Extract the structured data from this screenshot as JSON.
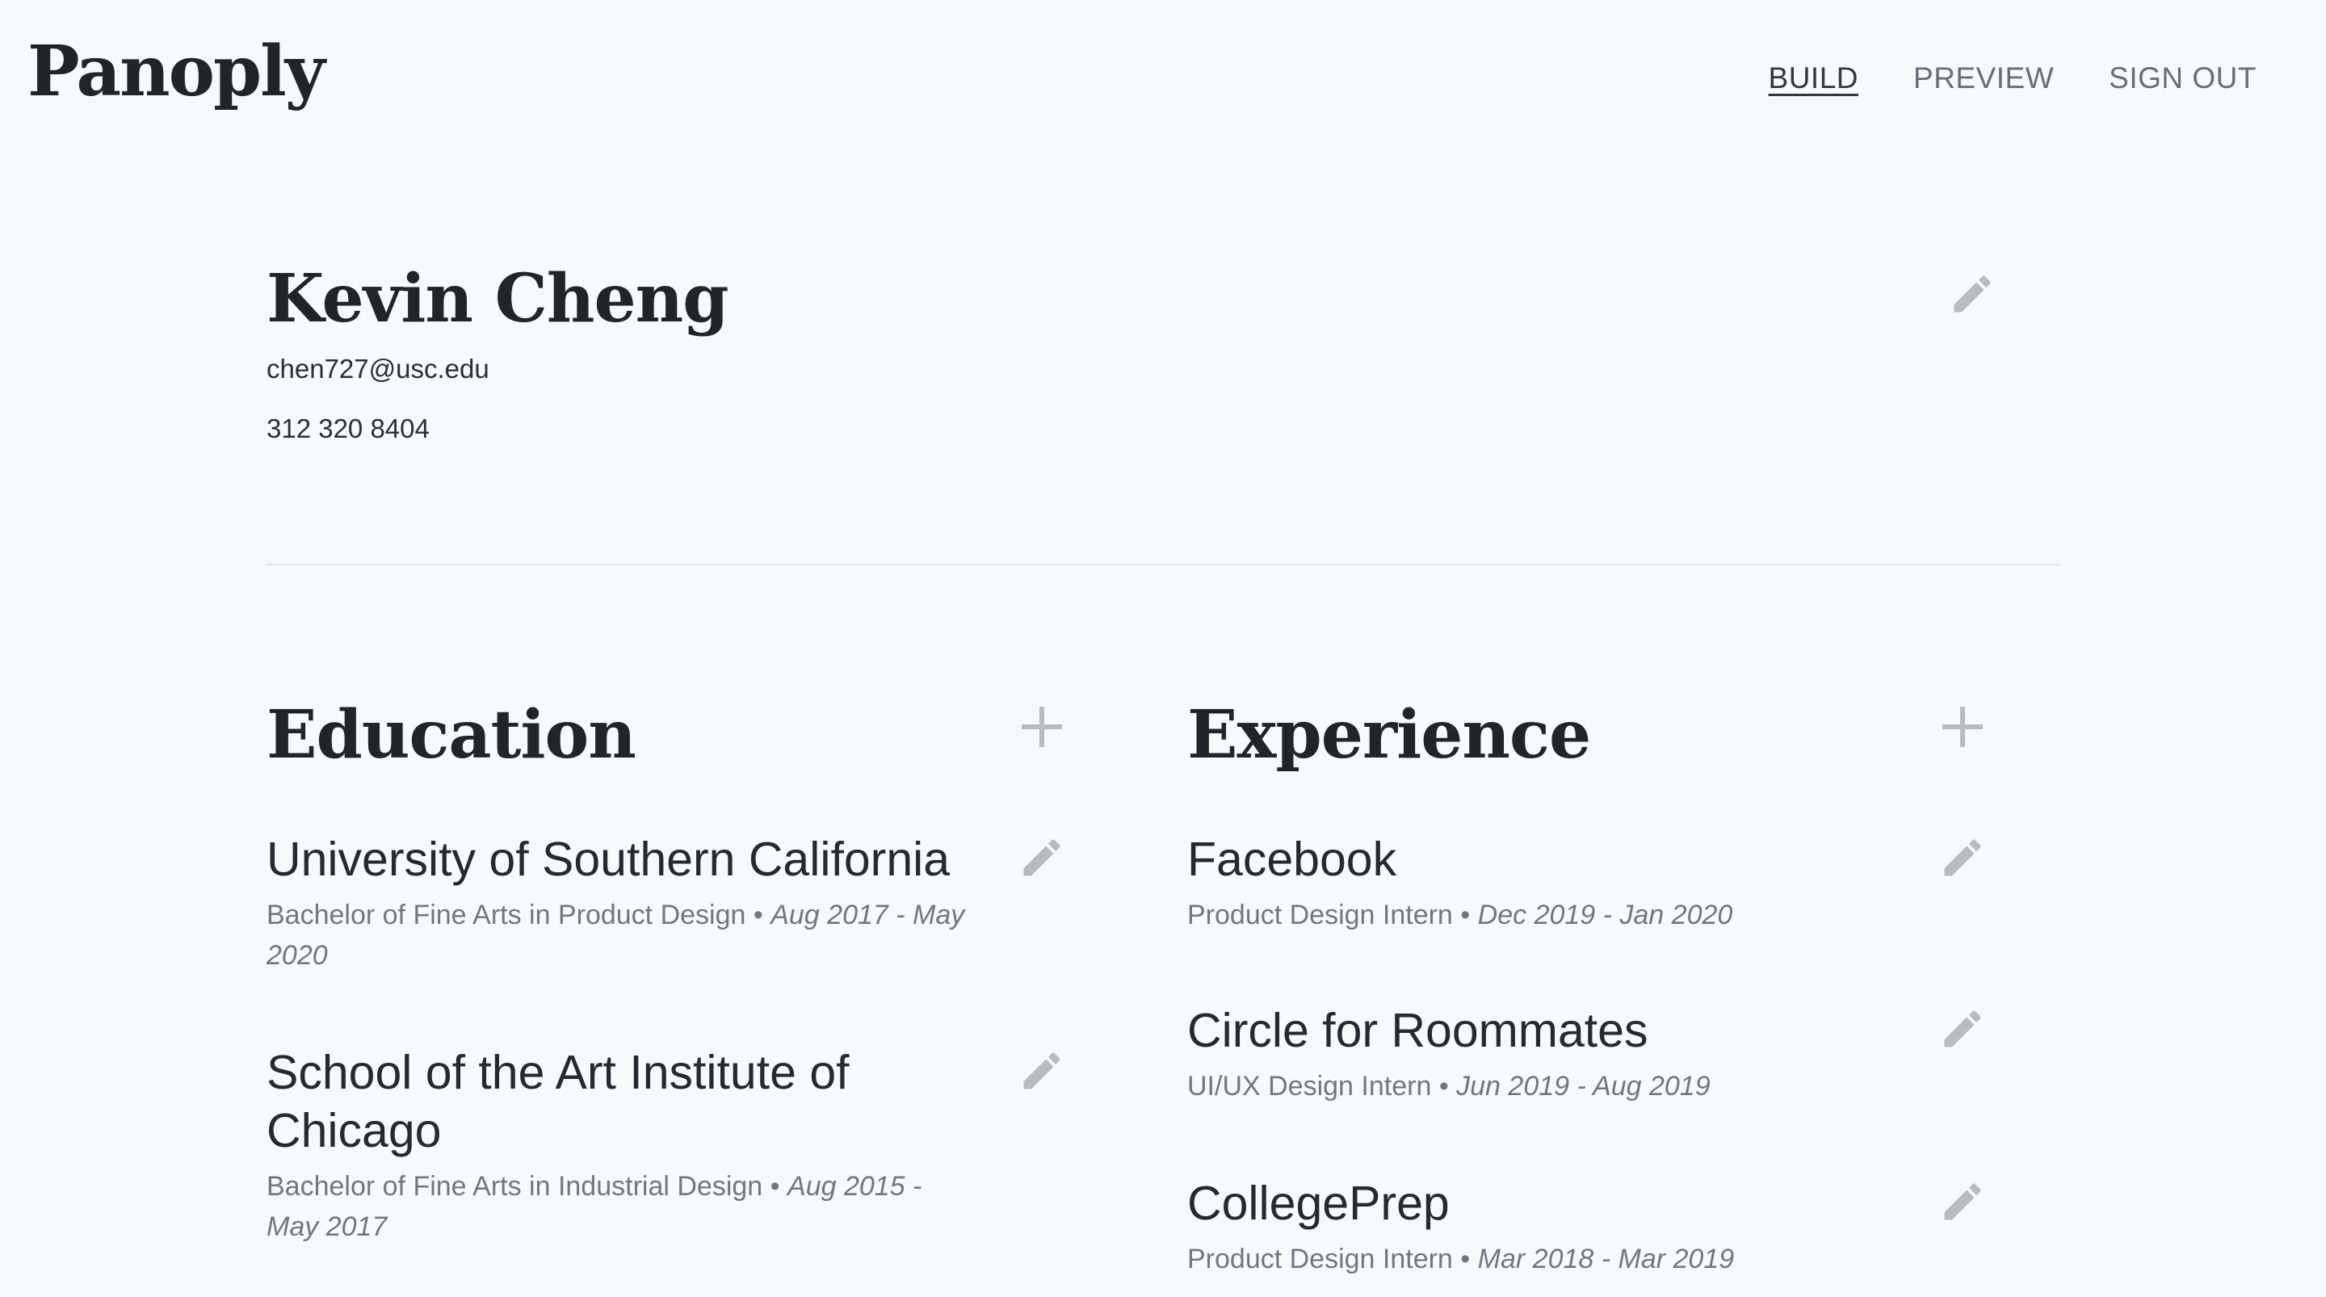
{
  "app": {
    "logo": "Panoply"
  },
  "nav": {
    "build": "BUILD",
    "preview": "PREVIEW",
    "sign_out": "SIGN OUT"
  },
  "profile": {
    "name": "Kevin Cheng",
    "email": "chen727@usc.edu",
    "phone": "312 320 8404"
  },
  "education": {
    "title": "Education",
    "entries": [
      {
        "school": "University of Southern California",
        "degree": "Bachelor of Fine Arts in Product Design",
        "separator": "•",
        "dates": "Aug 2017 - May 2020"
      },
      {
        "school": "School of the Art Institute of Chicago",
        "degree": "Bachelor of Fine Arts in Industrial Design",
        "separator": "•",
        "dates": "Aug 2015 - May 2017"
      }
    ]
  },
  "experience": {
    "title": "Experience",
    "entries": [
      {
        "company": "Facebook",
        "role": "Product Design Intern",
        "separator": "•",
        "dates": "Dec 2019 - Jan 2020"
      },
      {
        "company": "Circle for Roommates",
        "role": "UI/UX Design Intern",
        "separator": "•",
        "dates": "Jun 2019 - Aug 2019"
      },
      {
        "company": "CollegePrep",
        "role": "Product Design Intern",
        "separator": "•",
        "dates": "Mar 2018 - Mar 2019"
      }
    ]
  },
  "icons": {
    "edit": "pencil-icon",
    "add": "plus-icon"
  },
  "colors": {
    "background": "#f8f9fb",
    "text": "#222427",
    "muted": "#73777d",
    "icon": "#b9bbbe",
    "divider": "#e1e3e6"
  }
}
